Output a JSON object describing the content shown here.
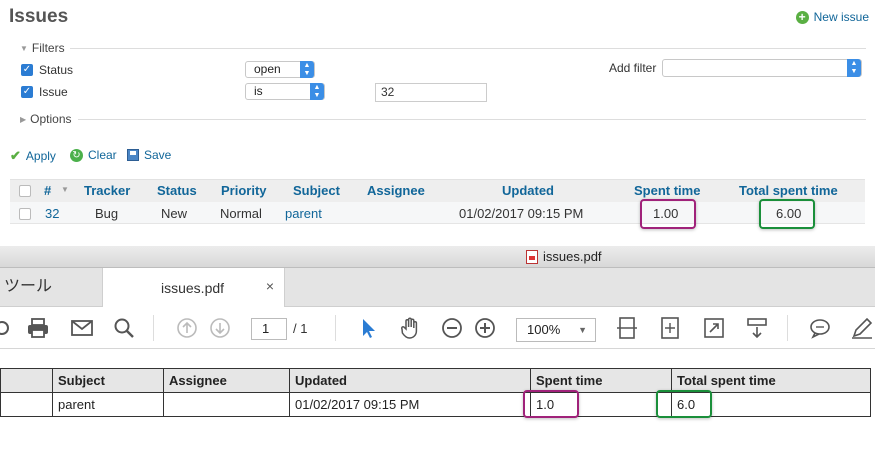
{
  "page": {
    "title": "Issues",
    "new_issue_label": "New issue"
  },
  "filters": {
    "legend": "Filters",
    "status": {
      "label": "Status",
      "operator": "open"
    },
    "issue": {
      "label": "Issue",
      "operator": "is",
      "value": "32"
    },
    "add_filter_label": "Add filter"
  },
  "options": {
    "legend": "Options"
  },
  "actions": {
    "apply": "Apply",
    "clear": "Clear",
    "save": "Save"
  },
  "issues_table": {
    "columns": [
      "#",
      "Tracker",
      "Status",
      "Priority",
      "Subject",
      "Assignee",
      "Updated",
      "Spent time",
      "Total spent time"
    ],
    "row": {
      "id": "32",
      "tracker": "Bug",
      "status": "New",
      "priority": "Normal",
      "subject": "parent",
      "assignee": "",
      "updated": "01/02/2017 09:15 PM",
      "spent_time": "1.00",
      "total_spent_time": "6.00"
    }
  },
  "viewer": {
    "window_title": "issues.pdf",
    "tools_tab": "ツール",
    "doc_tab": "issues.pdf",
    "close_glyph": "×",
    "page_current": "1",
    "page_total": "/ 1",
    "zoom": "100%",
    "icons": [
      "print-icon",
      "mail-icon",
      "search-icon",
      "page-up-icon",
      "page-down-icon",
      "cursor-icon",
      "hand-icon",
      "zoom-out-icon",
      "zoom-in-icon",
      "fit-page-icon",
      "full-screen-icon",
      "expand-icon",
      "scroll-mode-icon",
      "comment-icon",
      "pen-icon"
    ]
  },
  "pdf_table": {
    "columns": [
      "Subject",
      "Assignee",
      "Updated",
      "Spent time",
      "Total spent time"
    ],
    "row": {
      "subject": "parent",
      "assignee": "",
      "updated": "01/02/2017 09:15 PM",
      "spent_time": "1.0",
      "total_spent_time": "6.0"
    }
  },
  "colors": {
    "link": "#116699",
    "highlight_purple": "#a0227a",
    "highlight_green": "#1a8f3a"
  }
}
